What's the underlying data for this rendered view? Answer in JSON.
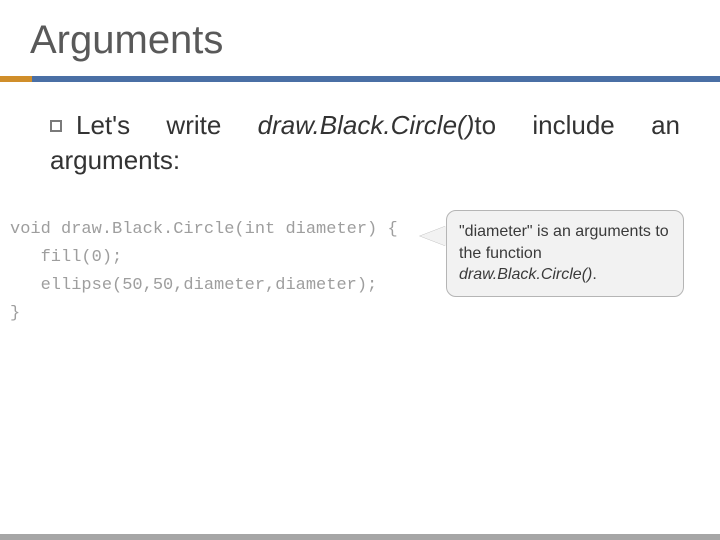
{
  "title": "Arguments",
  "body": {
    "prefix": "Let's write ",
    "function_name": "draw.Black.Circle()",
    "suffix": "to include an arguments:"
  },
  "code": {
    "line1": "void draw.Black.Circle(int diameter) {",
    "line2": "   fill(0);",
    "line3": "   ellipse(50,50,diameter,diameter);",
    "line4": "}"
  },
  "callout": {
    "text_part1": "\"diameter\" is an arguments to the function ",
    "function_name": "draw.Black.Circle()",
    "text_part2": "."
  }
}
